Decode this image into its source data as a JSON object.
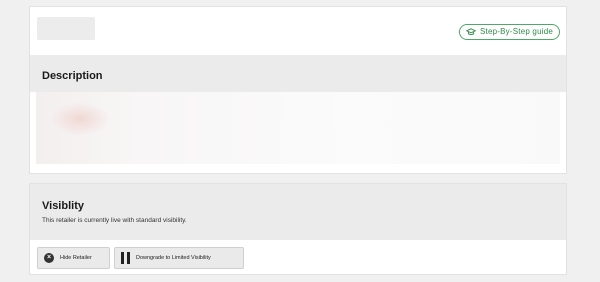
{
  "header": {
    "guide_label": "Step-By-Step guide"
  },
  "description": {
    "title": "Description"
  },
  "visibility": {
    "title": "Visiblity",
    "status_text": "This retailer is currently live with standard visibility.",
    "hide_label": "Hide Retailer",
    "downgrade_label": "Downgrade to Limited Visibility"
  },
  "colors": {
    "accent_green": "#2e8b47",
    "section_bg": "#ebebeb",
    "page_bg": "#f0f0f0"
  },
  "icons": {
    "guide": "graduation-cap-icon",
    "hide": "close-circle-icon",
    "downgrade": "pause-icon"
  }
}
